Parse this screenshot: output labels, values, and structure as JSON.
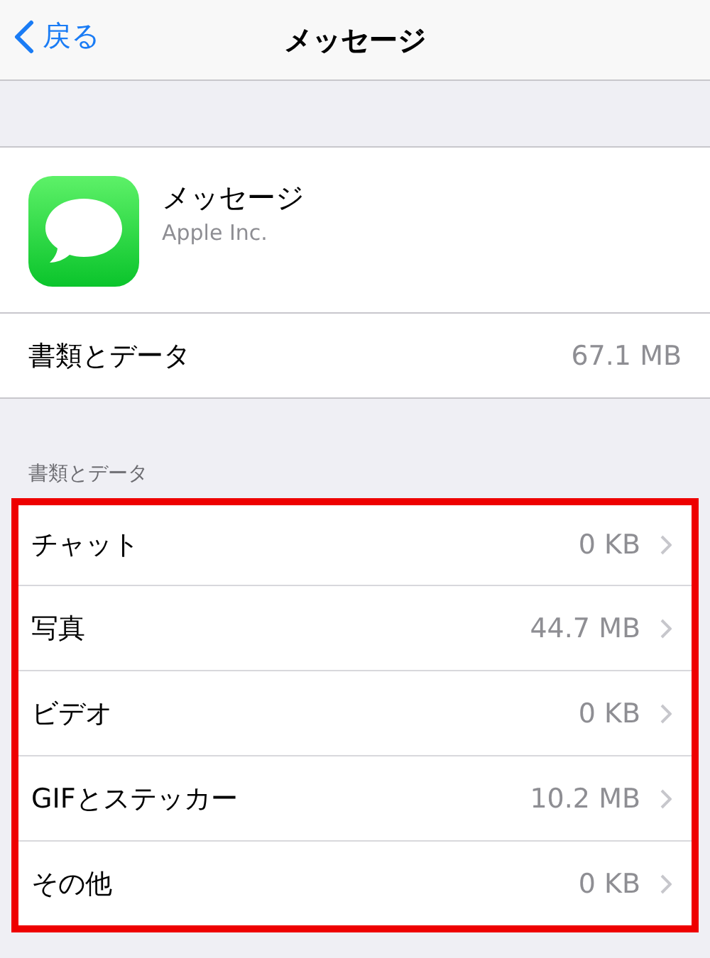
{
  "nav": {
    "back_label": "戻る",
    "title": "メッセージ"
  },
  "app": {
    "name": "メッセージ",
    "developer": "Apple Inc."
  },
  "summary": {
    "label": "書類とデータ",
    "value": "67.1 MB"
  },
  "section": {
    "header": "書類とデータ",
    "highlighted": true,
    "rows": [
      {
        "label": "チャット",
        "value": "0 KB"
      },
      {
        "label": "写真",
        "value": "44.7 MB"
      },
      {
        "label": "ビデオ",
        "value": "0 KB"
      },
      {
        "label": "GIFとステッカー",
        "value": "10.2 MB"
      },
      {
        "label": "その他",
        "value": "0 KB"
      }
    ]
  }
}
